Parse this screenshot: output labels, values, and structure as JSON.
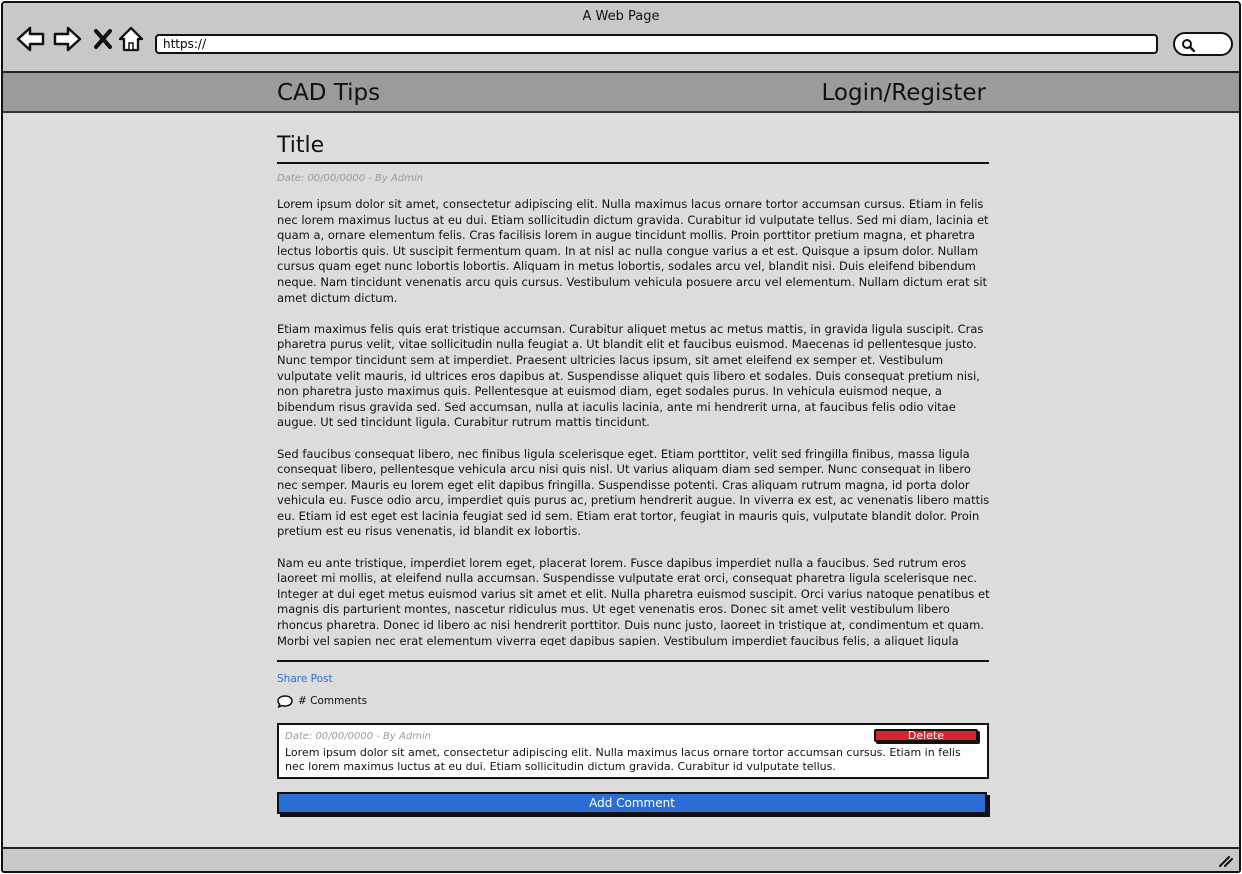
{
  "window": {
    "title": "A Web Page"
  },
  "browser": {
    "url": "https://",
    "icons": [
      "back-arrow-icon",
      "forward-arrow-icon",
      "close-x-icon",
      "home-icon",
      "search-icon"
    ]
  },
  "header": {
    "site_title": "CAD Tips",
    "login_label": "Login/Register"
  },
  "post": {
    "title": "Title",
    "meta": "Date: 00/00/0000 - By Admin",
    "paragraphs": [
      "Lorem ipsum dolor sit amet, consectetur adipiscing elit. Nulla maximus lacus ornare tortor accumsan cursus. Etiam in felis nec lorem maximus luctus at eu dui. Etiam sollicitudin dictum gravida. Curabitur id vulputate tellus. Sed mi diam, lacinia et quam a, ornare elementum felis. Cras facilisis lorem in augue tincidunt mollis. Proin porttitor pretium magna, et pharetra lectus lobortis quis. Ut suscipit fermentum quam. In at nisl ac nulla congue varius a et est. Quisque a ipsum dolor. Nullam cursus quam eget nunc lobortis lobortis. Aliquam in metus lobortis, sodales arcu vel, blandit nisi. Duis eleifend bibendum neque. Nam tincidunt venenatis arcu quis cursus. Vestibulum vehicula posuere arcu vel elementum. Nullam dictum erat sit amet dictum dictum.",
      "Etiam maximus felis quis erat tristique accumsan. Curabitur aliquet metus ac metus mattis, in gravida ligula suscipit. Cras pharetra purus velit, vitae sollicitudin nulla feugiat a. Ut blandit elit et faucibus euismod. Maecenas id pellentesque justo. Nunc tempor tincidunt sem at imperdiet. Praesent ultricies lacus ipsum, sit amet eleifend ex semper et. Vestibulum vulputate velit mauris, id ultrices eros dapibus at. Suspendisse aliquet quis libero et sodales. Duis consequat pretium nisi, non pharetra justo maximus quis. Pellentesque at euismod diam, eget sodales purus. In vehicula euismod neque, a bibendum risus gravida sed. Sed accumsan, nulla at iaculis lacinia, ante mi hendrerit urna, at faucibus felis odio vitae augue. Ut sed tincidunt ligula. Curabitur rutrum mattis tincidunt.",
      "Sed faucibus consequat libero, nec finibus ligula scelerisque eget. Etiam porttitor, velit sed fringilla finibus, massa ligula consequat libero, pellentesque vehicula arcu nisi quis nisl. Ut varius aliquam diam sed semper. Nunc consequat in libero nec semper. Mauris eu lorem eget elit dapibus fringilla. Suspendisse potenti. Cras aliquam rutrum magna, id porta dolor vehicula eu. Fusce odio arcu, imperdiet quis purus ac, pretium hendrerit augue. In viverra ex est, ac venenatis libero mattis eu. Etiam id est eget est lacinia feugiat sed id sem. Etiam erat tortor, feugiat in mauris quis, vulputate blandit dolor. Proin pretium est eu risus venenatis, id blandit ex lobortis.",
      "Nam eu ante tristique, imperdiet lorem eget, placerat lorem. Fusce dapibus imperdiet nulla a faucibus. Sed rutrum eros laoreet mi mollis, at eleifend nulla accumsan. Suspendisse vulputate erat orci, consequat pharetra ligula scelerisque nec. Integer at dui eget metus euismod varius sit amet et elit. Nulla pharetra euismod suscipit. Orci varius natoque penatibus et magnis dis parturient montes, nascetur ridiculus mus. Ut eget venenatis eros. Donec sit amet velit vestibulum libero rhoncus pharetra. Donec id libero ac nisi hendrerit porttitor. Duis nunc justo, laoreet in tristique at, condimentum et quam. Morbi vel sapien nec erat elementum viverra eget dapibus sapien. Vestibulum imperdiet faucibus felis, a aliquet ligula"
    ],
    "share_label": "Share Post",
    "comments_label": "# Comments"
  },
  "comment": {
    "meta": "Date: 00/00/0000 - By Admin",
    "text": "Lorem ipsum dolor sit amet, consectetur adipiscing elit. Nulla maximus lacus ornare tortor accumsan cursus. Etiam in felis nec lorem maximus luctus at eu dui. Etiam sollicitudin dictum gravida. Curabitur id vulputate tellus.",
    "delete_label": "Delete"
  },
  "actions": {
    "add_comment_label": "Add Comment"
  },
  "colors": {
    "accent_blue": "#2b6ed8",
    "delete_red": "#d8232a",
    "page_background": "#dcdcdc",
    "header_gray": "#9b9b9b"
  }
}
